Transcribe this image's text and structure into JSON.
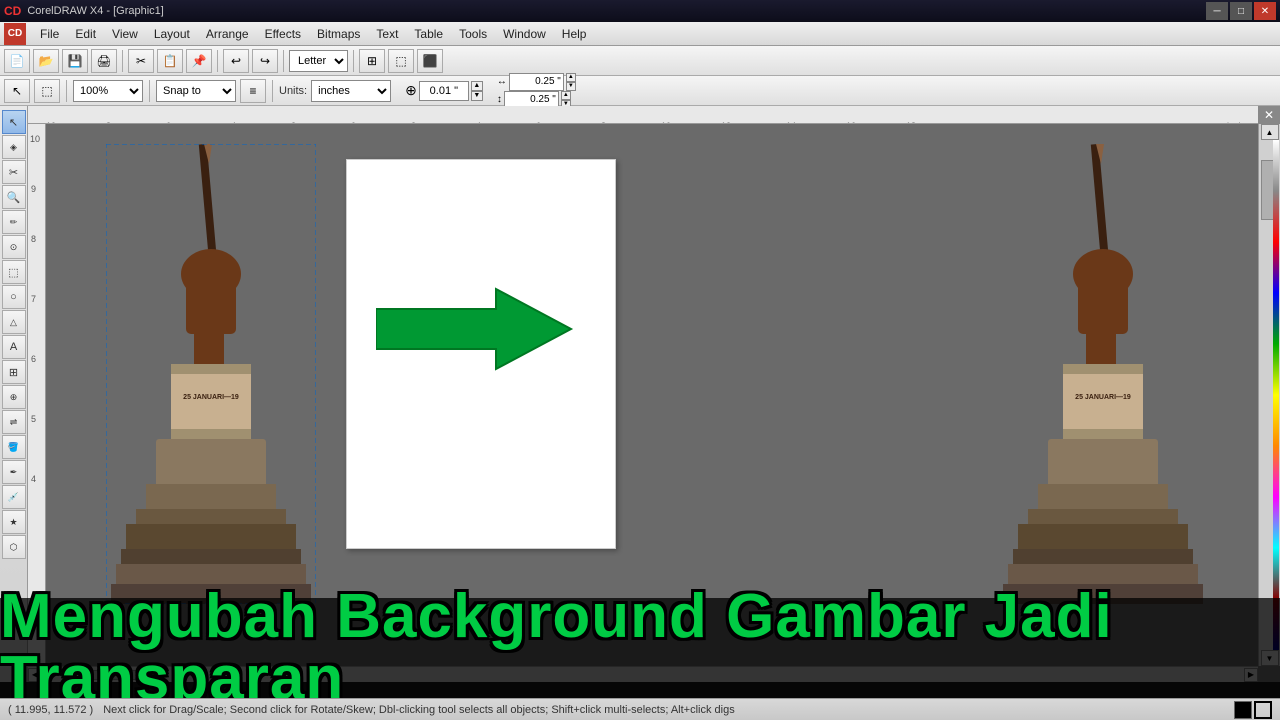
{
  "titlebar": {
    "title": "CorelDRAW X4 - [Graphic1]",
    "min_label": "─",
    "max_label": "□",
    "close_label": "✕"
  },
  "menubar": {
    "logo": "CD",
    "items": [
      "File",
      "Edit",
      "View",
      "Layout",
      "Arrange",
      "Effects",
      "Bitmaps",
      "Text",
      "Table",
      "Tools",
      "Window",
      "Help"
    ]
  },
  "toolbar1": {
    "buttons": [
      "📂",
      "💾",
      "🖨",
      "✂"
    ],
    "paper_size": "Letter"
  },
  "toolbar2": {
    "zoom": "100%",
    "snap_label": "Snap to",
    "units_label": "Units:",
    "units_value": "inches",
    "nudge_value": "0.01 \"",
    "margin_h": "0.25 \"",
    "margin_v": "0.25 \""
  },
  "tools": [
    "↖",
    "✋",
    "✏",
    "⬚",
    "○",
    "⬡",
    "✎",
    "🔍",
    "✒",
    "🪣",
    "🎨",
    "⬜",
    "○",
    "△",
    "☆",
    "A",
    "⊞",
    "⊙"
  ],
  "canvas": {
    "zoom_percent": "100%",
    "snap_to": "Snap to",
    "units": "inches",
    "nudge": "0.01",
    "margin1": "0.25",
    "margin2": "0.25"
  },
  "palette": {
    "colors": [
      "#ffffff",
      "#000000",
      "#c0c0c0",
      "#ff0000",
      "#0000ff",
      "#00aa00",
      "#ffff00",
      "#ff6600",
      "#ff00ff",
      "#00ffff",
      "#aa0000",
      "#0000aa"
    ]
  },
  "statusbar": {
    "coords": "( 11.995, 11.572 )",
    "hint": "Next click for Drag/Scale; Second click for Rotate/Skew; Dbl-clicking tool selects all objects; Shift+click multi-selects; Alt+click digs"
  },
  "overlay_title": "Mengubah Background Gambar Jadi Transparan",
  "ruler": {
    "top_labels": [
      "10",
      "8",
      "6",
      "4",
      "2",
      "0",
      "2",
      "4",
      "6",
      "8",
      "10",
      "12",
      "14",
      "16",
      "18"
    ],
    "unit": "inches"
  }
}
